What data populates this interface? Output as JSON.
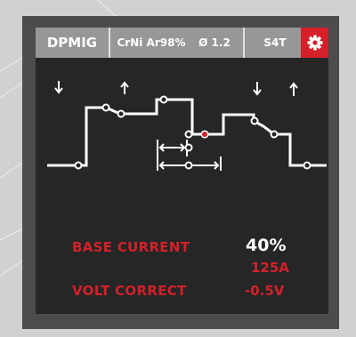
{
  "topbar": {
    "mode": "DPMIG",
    "material": "CrNi Ar98%",
    "diameter": "Ø 1.2",
    "trigger": "S4T"
  },
  "params": {
    "base_current_label": "BASE CURRENT",
    "base_current_value": "40%",
    "base_current_amps": "125A",
    "volt_correct_label": "VOLT CORRECT",
    "volt_correct_value": "-0.5V"
  },
  "colors": {
    "accent": "#d2202a",
    "screen": "#262626",
    "topbar": "#979797",
    "frame": "#4c4c4c"
  }
}
